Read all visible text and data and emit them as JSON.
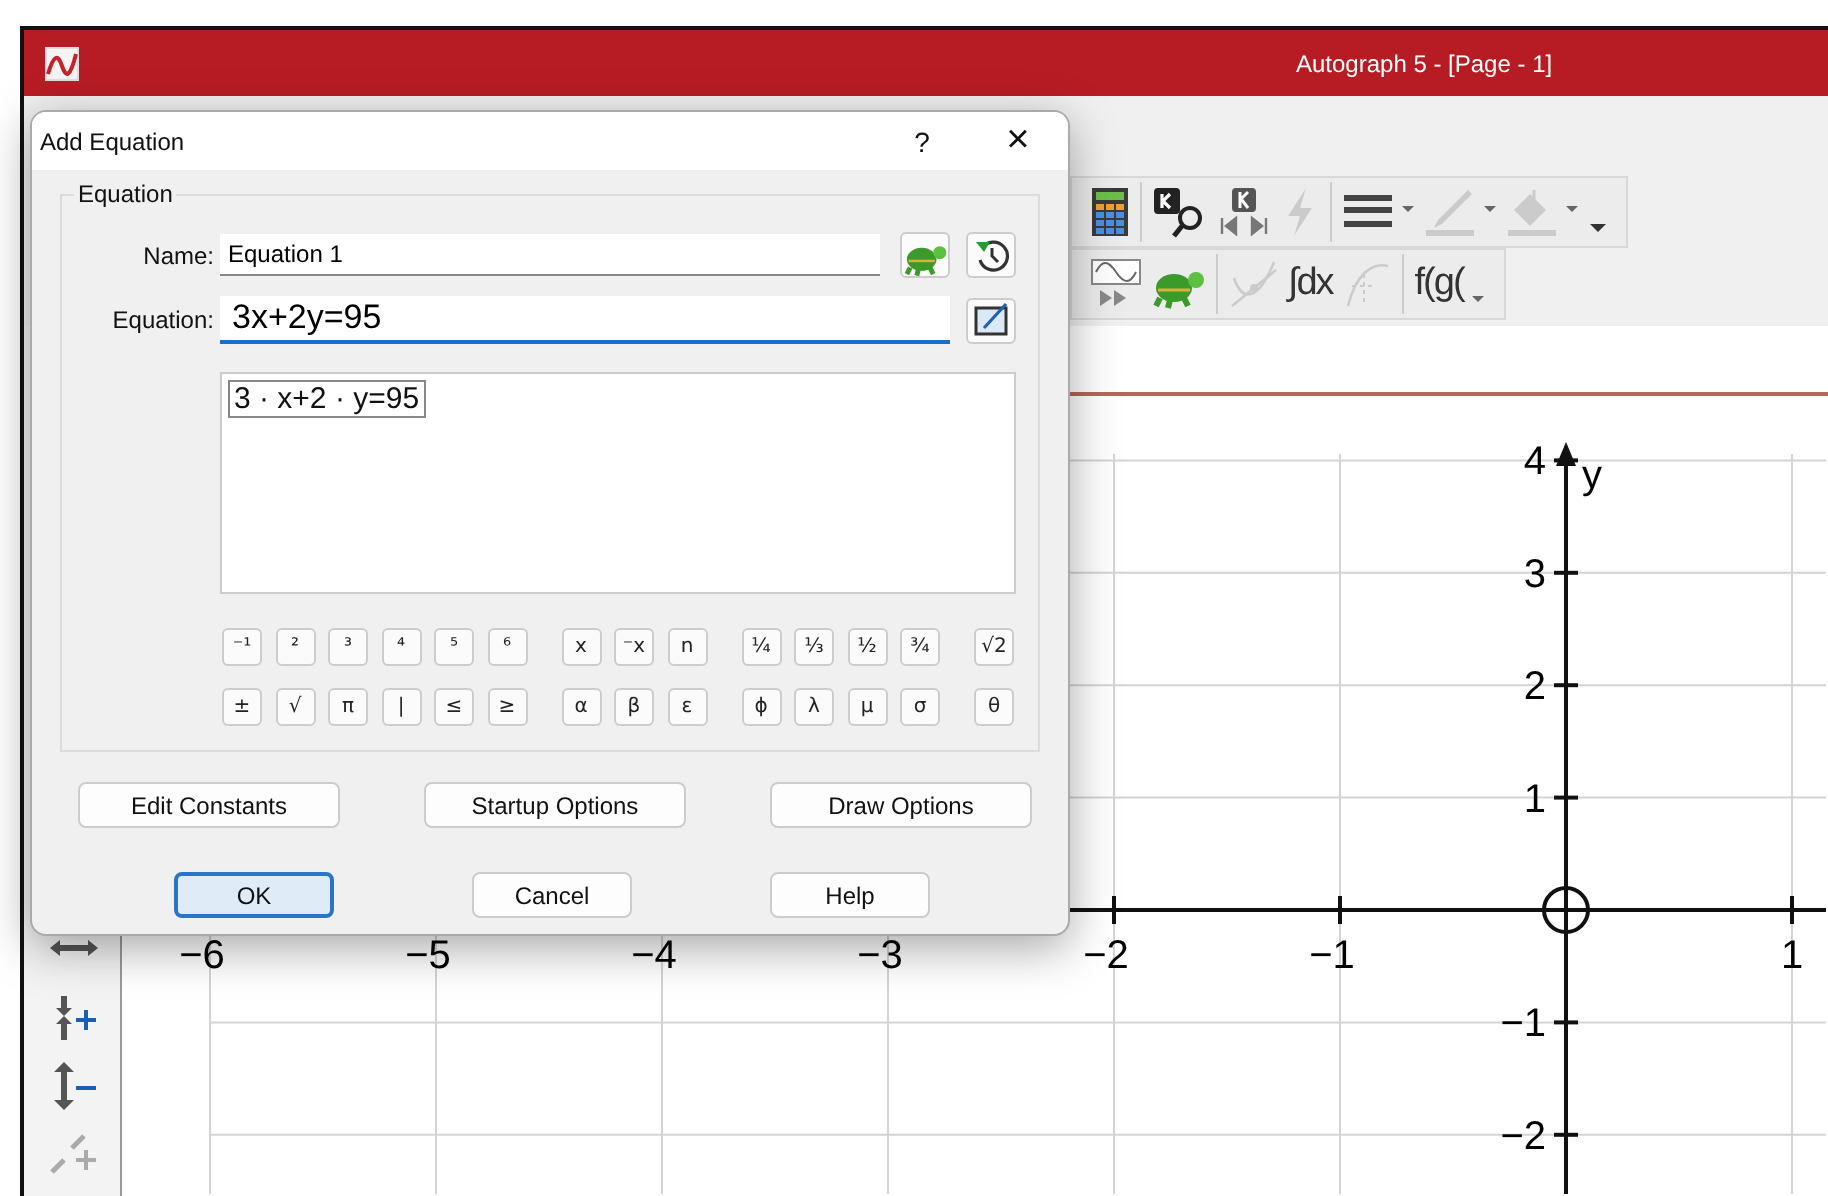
{
  "app_window": {
    "title": "Autograph 5 - [Page - 1]"
  },
  "toolbars": [
    [
      [
        {
          "kind": "calculator",
          "disabled": false,
          "dropdown": false
        }
      ],
      [
        {
          "kind": "key-search",
          "disabled": false,
          "dropdown": false
        },
        {
          "kind": "key-player",
          "disabled": false,
          "dropdown": false
        },
        {
          "kind": "lightning",
          "disabled": true,
          "dropdown": false
        }
      ],
      [
        {
          "kind": "line-style",
          "disabled": false,
          "dropdown": true
        },
        {
          "kind": "pen",
          "disabled": true,
          "dropdown": true
        },
        {
          "kind": "fill",
          "disabled": true,
          "dropdown": true
        },
        {
          "kind": "overflow",
          "disabled": false,
          "dropdown": false
        }
      ]
    ],
    [
      [
        {
          "kind": "animate",
          "disabled": false,
          "dropdown": false
        },
        {
          "kind": "turtle",
          "disabled": false,
          "dropdown": false
        }
      ],
      [
        {
          "kind": "tangent",
          "disabled": true,
          "dropdown": false
        },
        {
          "kind": "text",
          "label": "∫dx",
          "disabled": false,
          "dropdown": false
        },
        {
          "kind": "derivative",
          "disabled": true,
          "dropdown": false
        }
      ],
      [
        {
          "kind": "text",
          "label": "f(g(",
          "disabled": false,
          "dropdown": true
        }
      ]
    ]
  ],
  "side_toolbar": [
    {
      "kind": "shrink-horizontal",
      "disabled": false
    },
    {
      "kind": "stretch-vertical",
      "disabled": false
    },
    {
      "kind": "shrink-vertical",
      "disabled": false
    },
    {
      "kind": "enlarge",
      "disabled": true
    }
  ],
  "graph": {
    "y_axis_label": "y",
    "x_tick_labels_negative": [
      "−6",
      "−5",
      "−4",
      "−3",
      "−2",
      "−1"
    ],
    "x_tick_labels_positive": [
      "1"
    ],
    "y_tick_labels_positive": [
      "4",
      "3",
      "2",
      "1"
    ],
    "y_tick_labels_negative": [
      "−1",
      "−2"
    ]
  },
  "dialog": {
    "title": "Add Equation",
    "help_button": "?",
    "close_button": "×",
    "group_label": "Equation",
    "name_label": "Name:",
    "name_value": "Equation 1",
    "equation_label": "Equation:",
    "equation_value": "3x+2y=95",
    "preview": "3 · x+2 · y=95",
    "keypad": [
      [
        [
          "⁻¹",
          "²",
          "³",
          "⁴",
          "⁵",
          "⁶"
        ],
        [
          "x",
          "⁻x",
          "n"
        ],
        [
          "¼",
          "⅓",
          "½",
          "¾"
        ],
        [
          "√2"
        ]
      ],
      [
        [
          "±",
          "√",
          "π",
          "|",
          "≤",
          "≥"
        ],
        [
          "α",
          "β",
          "ε"
        ],
        [
          "ϕ",
          "λ",
          "μ",
          "σ"
        ],
        [
          "θ"
        ]
      ]
    ],
    "option_buttons": [
      "Edit Constants",
      "Startup Options",
      "Draw Options"
    ],
    "buttons": [
      {
        "label": "OK",
        "default": true
      },
      {
        "label": "Cancel",
        "default": false
      },
      {
        "label": "Help",
        "default": false
      }
    ]
  }
}
